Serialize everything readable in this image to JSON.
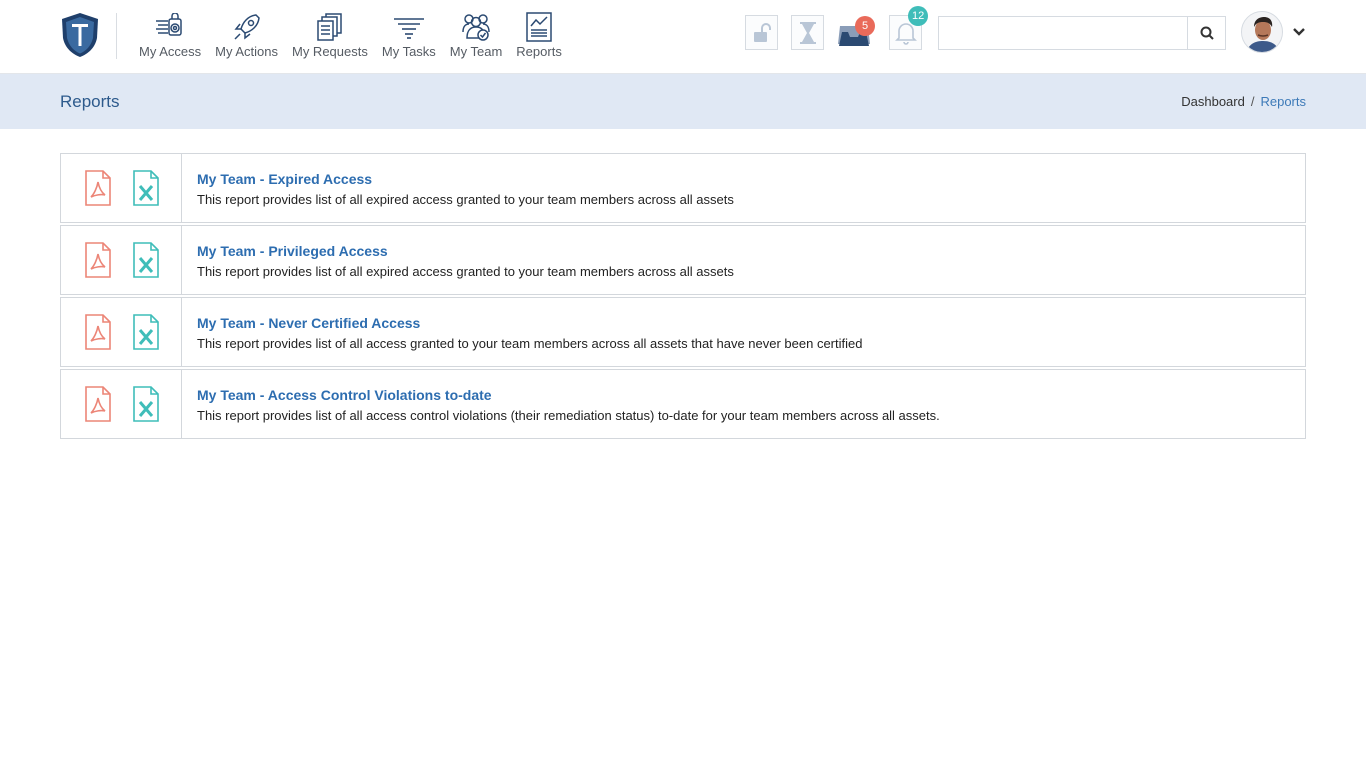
{
  "nav": {
    "items": [
      {
        "label": "My Access",
        "icon": "access-icon"
      },
      {
        "label": "My Actions",
        "icon": "rocket-icon"
      },
      {
        "label": "My Requests",
        "icon": "documents-icon"
      },
      {
        "label": "My Tasks",
        "icon": "funnel-icon"
      },
      {
        "label": "My Team",
        "icon": "team-icon"
      },
      {
        "label": "Reports",
        "icon": "report-icon"
      }
    ]
  },
  "toolbar": {
    "inbox_badge": "5",
    "notifications_badge": "12"
  },
  "search": {
    "value": "",
    "placeholder": ""
  },
  "header": {
    "title": "Reports",
    "breadcrumb": [
      "Dashboard",
      "Reports"
    ],
    "breadcrumb_separator": "/"
  },
  "reports": [
    {
      "title": "My Team - Expired Access",
      "description": "This report provides list of all expired access granted to your team members across all assets"
    },
    {
      "title": "My Team - Privileged Access",
      "description": "This report provides list of all expired access granted to your team members across all assets"
    },
    {
      "title": "My Team - Never Certified Access",
      "description": "This report provides list of all access granted to your team members across all assets that have never been certified"
    },
    {
      "title": "My Team - Access Control Violations to-date",
      "description": "This report provides list of all access control violations (their remediation status) to-date for your team members across all assets."
    }
  ],
  "colors": {
    "brand_navy": "#1f3f6b",
    "link_blue": "#2d6db0",
    "pdf_red": "#ec8577",
    "excel_teal": "#3fbdb9",
    "title_bar_bg": "#e0e8f4",
    "badge_red": "#e96a5a",
    "badge_teal": "#3fbdb9"
  }
}
